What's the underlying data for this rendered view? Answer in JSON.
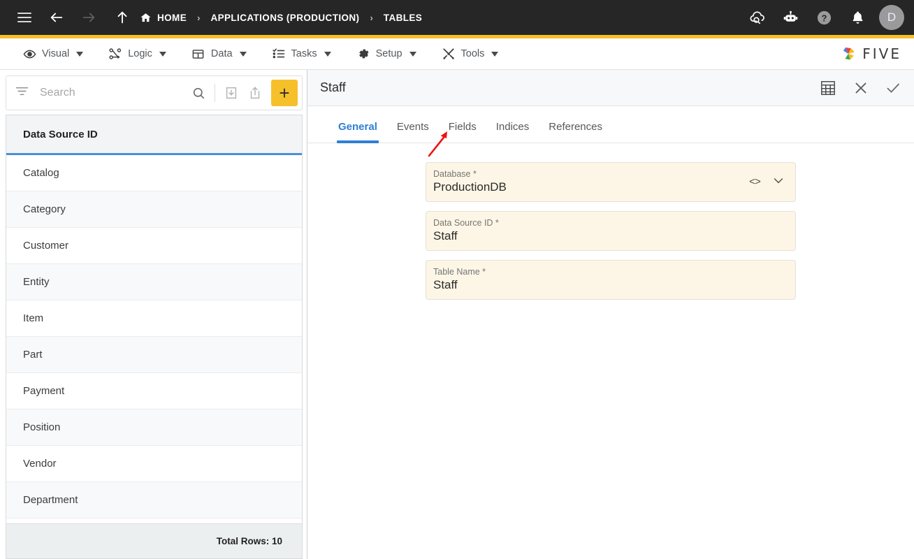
{
  "topbar": {
    "menu_icon": "hamburger-icon",
    "back_icon": "arrow-left-icon",
    "forward_icon": "arrow-right-icon",
    "up_icon": "arrow-up-icon",
    "breadcrumbs": [
      {
        "label": "HOME",
        "icon": "home-icon"
      },
      {
        "label": "APPLICATIONS (PRODUCTION)",
        "icon": ""
      },
      {
        "label": "TABLES",
        "icon": ""
      }
    ],
    "separator": "›",
    "right_icons": [
      "cloud-search-icon",
      "robot-icon",
      "help-icon",
      "bell-icon"
    ],
    "avatar_initial": "D",
    "background": "#262626",
    "accent_color": "#f5c029"
  },
  "menubar": {
    "items": [
      {
        "label": "Visual",
        "icon": "eye-icon"
      },
      {
        "label": "Logic",
        "icon": "workflow-icon"
      },
      {
        "label": "Data",
        "icon": "table-icon"
      },
      {
        "label": "Tasks",
        "icon": "checklist-icon"
      },
      {
        "label": "Setup",
        "icon": "gear-icon"
      },
      {
        "label": "Tools",
        "icon": "tools-icon"
      }
    ],
    "logo_text": "FIVE"
  },
  "sidebar": {
    "search": {
      "placeholder": "Search",
      "value": ""
    },
    "toolbar": {
      "filter_icon": "filter-icon",
      "search_icon": "search-icon",
      "import_icon": "import-icon",
      "export_icon": "export-icon",
      "add_label": "+"
    },
    "column_header": "Data Source ID",
    "rows": [
      "Catalog",
      "Category",
      "Customer",
      "Entity",
      "Item",
      "Part",
      "Payment",
      "Position",
      "Vendor",
      "Department"
    ],
    "footer": "Total Rows: 10",
    "selection_color": "#4a90d9"
  },
  "detail": {
    "title": "Staff",
    "header_icons": [
      "grid-icon",
      "close-icon",
      "confirm-icon"
    ],
    "tabs": [
      {
        "label": "General",
        "active": true
      },
      {
        "label": "Events",
        "active": false
      },
      {
        "label": "Fields",
        "active": false
      },
      {
        "label": "Indices",
        "active": false
      },
      {
        "label": "References",
        "active": false
      }
    ],
    "active_tab_color": "#2f7fd1",
    "fields": [
      {
        "label": "Database *",
        "value": "ProductionDB",
        "has_code_icon": true,
        "has_dropdown": true
      },
      {
        "label": "Data Source ID *",
        "value": "Staff",
        "has_code_icon": false,
        "has_dropdown": false
      },
      {
        "label": "Table Name *",
        "value": "Staff",
        "has_code_icon": false,
        "has_dropdown": false
      }
    ],
    "field_bg": "#fdf6e6"
  },
  "annotation": {
    "arrow_color": "#ee1111",
    "points_to": "Fields"
  }
}
